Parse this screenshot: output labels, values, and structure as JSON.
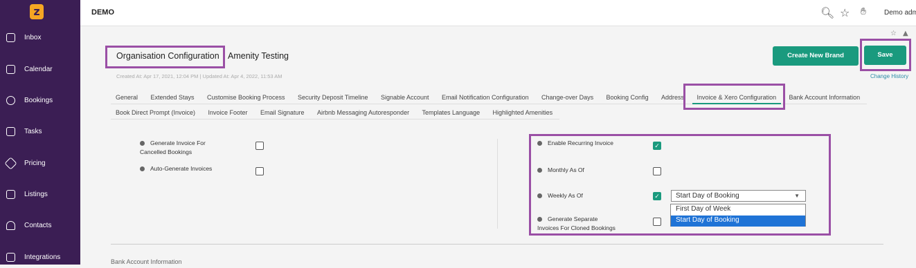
{
  "app": {
    "brand": "DEMO",
    "user": "Demo admi"
  },
  "sidebar": {
    "items": [
      {
        "label": "Inbox",
        "icon": "inbox-icon"
      },
      {
        "label": "Calendar",
        "icon": "calendar-icon"
      },
      {
        "label": "Bookings",
        "icon": "bookings-icon"
      },
      {
        "label": "Tasks",
        "icon": "tasks-icon"
      },
      {
        "label": "Pricing",
        "icon": "tag-icon"
      },
      {
        "label": "Listings",
        "icon": "home-icon"
      },
      {
        "label": "Contacts",
        "icon": "person-icon"
      },
      {
        "label": "Integrations",
        "icon": "integrations-icon"
      }
    ]
  },
  "header": {
    "title": "Organisation Configuration",
    "subtitle": "Amenity Testing",
    "meta": "Created At: Apr 17, 2021, 12:04 PM  |  Updated At: Apr 4, 2022, 11:53 AM",
    "create_brand_label": "Create New Brand",
    "save_label": "Save",
    "change_history_label": "Change History"
  },
  "tabs": {
    "row1": [
      "General",
      "Extended Stays",
      "Customise Booking Process",
      "Security Deposit Timeline",
      "Signable Account",
      "Email Notification Configuration",
      "Change-over Days",
      "Booking Config",
      "Address",
      "Invoice & Xero Configuration",
      "Bank Account Information"
    ],
    "row2": [
      "Book Direct Prompt (Invoice)",
      "Invoice Footer",
      "Email Signature",
      "Airbnb Messaging Autoresponder",
      "Templates Language",
      "Highlighted Amenities"
    ],
    "active": "Invoice & Xero Configuration"
  },
  "left_fields": [
    {
      "label_line1": "Generate Invoice For",
      "label_line2": "Cancelled Bookings",
      "checked": false
    },
    {
      "label_line1": "Auto-Generate Invoices",
      "label_line2": "",
      "checked": false
    }
  ],
  "right_fields": [
    {
      "label_line1": "Enable Recurring Invoice",
      "label_line2": "",
      "checked": true
    },
    {
      "label_line1": "Monthly As Of",
      "label_line2": "",
      "checked": false
    },
    {
      "label_line1": "Weekly As Of",
      "label_line2": "",
      "checked": true
    },
    {
      "label_line1": "Generate Separate",
      "label_line2": "Invoices For Cloned Bookings",
      "checked": false
    }
  ],
  "weekly_select": {
    "value": "Start Day of Booking",
    "options": [
      "First Day of Week",
      "Start Day of Booking"
    ],
    "selected_index": 1
  },
  "next_section_title": "Bank Account Information",
  "colors": {
    "sidebar": "#3b1e54",
    "accent": "#1a9a7e",
    "highlight": "#9a4fa5"
  }
}
